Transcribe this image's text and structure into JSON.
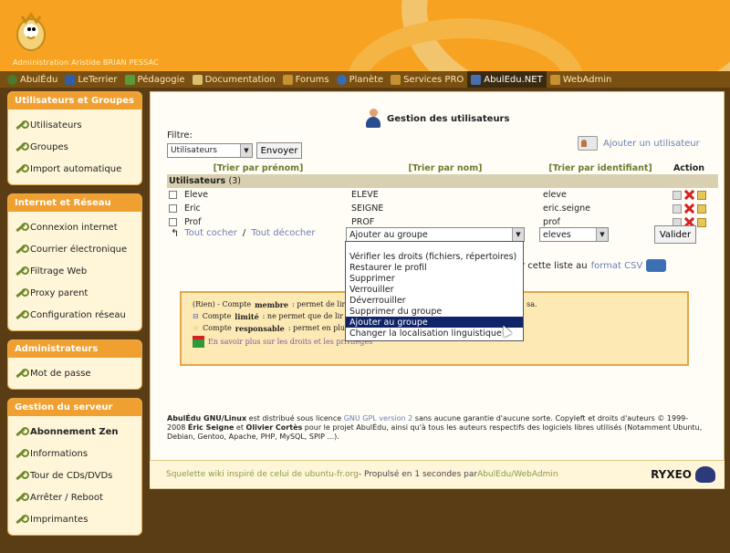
{
  "header": {
    "org_name": "Administration Aristide BRIAN PESSAC"
  },
  "nav": {
    "items": [
      {
        "label": "AbulÉdu",
        "icon": "#4a7a2a"
      },
      {
        "label": "LeTerrier",
        "icon": "#2f5fa8"
      },
      {
        "label": "Pédagogie",
        "icon": "#5a9a3a"
      },
      {
        "label": "Documentation",
        "icon": "#d8c070"
      },
      {
        "label": "Forums",
        "icon": "#c89030"
      },
      {
        "label": "Planète",
        "icon": "#3a6ab0"
      },
      {
        "label": "Services PRO",
        "icon": "#c89030"
      },
      {
        "label": "AbulEdu.NET",
        "icon": "#4a6fb0"
      },
      {
        "label": "WebAdmin",
        "icon": "#c89030"
      }
    ]
  },
  "sidebar": {
    "sections": [
      {
        "title": "Utilisateurs et Groupes",
        "items": [
          "Utilisateurs",
          "Groupes",
          "Import automatique"
        ]
      },
      {
        "title": "Internet et Réseau",
        "items": [
          "Connexion internet",
          "Courrier électronique",
          "Filtrage Web",
          "Proxy parent",
          "Configuration réseau"
        ]
      },
      {
        "title": "Administrateurs",
        "items": [
          "Mot de passe"
        ]
      },
      {
        "title": "Gestion du serveur",
        "items": [
          "Abonnement Zen",
          "Informations",
          "Tour de CDs/DVDs",
          "Arrêter / Reboot",
          "Imprimantes"
        ]
      }
    ]
  },
  "main": {
    "page_title": "Gestion des utilisateurs",
    "filter_label": "Filtre:",
    "filter_value": "Utilisateurs",
    "send_button": "Envoyer",
    "add_user": "Ajouter un utilisateur",
    "table": {
      "headers": [
        "[Trier par prénom]",
        "[Trier par nom]",
        "[Trier par identifiant]",
        "Action"
      ],
      "group_label": "Utilisateurs",
      "group_count": "(3)",
      "rows": [
        {
          "prenom": "Eleve",
          "nom": "ELEVE",
          "identifiant": "eleve"
        },
        {
          "prenom": "Eric",
          "nom": "SEIGNE",
          "identifiant": "eric.seigne"
        },
        {
          "prenom": "Prof",
          "nom": "PROF",
          "identifiant": "prof"
        }
      ]
    },
    "check_all": "Tout cocher",
    "slash": "/",
    "uncheck_all": "Tout décocher",
    "action_select_value": "Ajouter au groupe",
    "group_target_value": "eleves",
    "validate_button": "Valider",
    "csv_text": "r cette liste au",
    "csv_link": "format CSV"
  },
  "dropdown": {
    "options": [
      "Vérifier les droits (fichiers, répertoires)",
      "Restaurer le profil",
      "Supprimer",
      "Verrouiller",
      "Déverrouiller",
      "Supprimer du groupe",
      "Ajouter au groupe",
      "Changer la localisation linguistique"
    ],
    "selected_index": 6
  },
  "legend": {
    "line1_a": "(Rien) - Compte",
    "line1_b": "membre",
    "line1_c": ": permet de lire",
    "line1_end": "sa.",
    "line2_a": "Compte",
    "line2_b": "limité",
    "line2_c": ": ne permet que de lir",
    "line3_a": "Compte",
    "line3_b": "responsable",
    "line3_c": ": permet en plus",
    "line4": "En savoir plus sur les droits et les privilèges"
  },
  "license": {
    "p1": "AbulÉdu GNU/Linux",
    "p2": " est distribué sous licence ",
    "link": "GNU GPL version 2",
    "p3": " sans aucune garantie d'aucune sorte. Copyleft et droits d'auteurs © 1999-2008 ",
    "a1": "Éric Seigne",
    "p4": " et ",
    "a2": "Olivier Cortès",
    "p5": " pour le projet AbulÉdu, ainsi qu'à tous les auteurs respectifs des logiciels libres utilisés (Notamment Ubuntu, Debian, Gentoo, Apache, PHP, MySQL, SPIP ...)."
  },
  "footer": {
    "text_link": "Squelette wiki inspiré de celui de ubuntu-fr.org",
    "text_mid": " - Propulsé en 1 secondes par ",
    "text_link2": "AbulEdu/WebAdmin",
    "brand": "RYXEO"
  }
}
